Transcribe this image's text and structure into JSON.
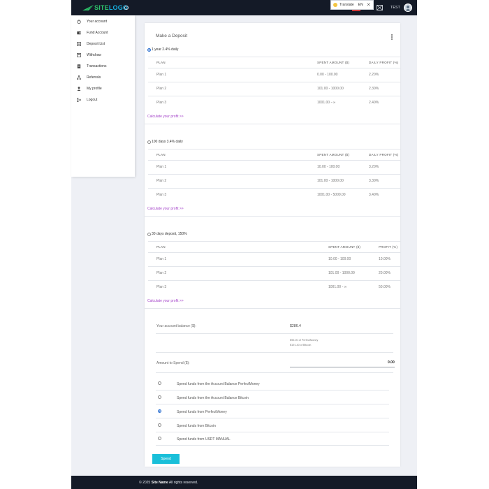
{
  "header": {
    "logo_part1": "SITE",
    "logo_part2": "LOGO",
    "translate_label": "Translate",
    "translate_lang": "EN",
    "translate_close": "✕",
    "user_name": "TEST"
  },
  "sidebar": {
    "items": [
      {
        "label": "Your account",
        "icon": "power-icon"
      },
      {
        "label": "Fund Account",
        "icon": "wallet-icon"
      },
      {
        "label": "Deposit List",
        "icon": "list-icon"
      },
      {
        "label": "Withdraw",
        "icon": "withdraw-icon"
      },
      {
        "label": "Transactions",
        "icon": "document-icon"
      },
      {
        "label": "Referrals",
        "icon": "network-icon"
      },
      {
        "label": "My profile",
        "icon": "user-icon"
      },
      {
        "label": "Logout",
        "icon": "logout-icon"
      }
    ]
  },
  "card": {
    "title": "Make a Deposit",
    "plans": [
      {
        "name": "1 year 2.4% daily",
        "selected": true,
        "columns": [
          "PLAN",
          "SPENT AMOUNT ($)",
          "DAILY PROFIT (%)"
        ],
        "rows": [
          [
            "Plan 1",
            "0.00 - 100.00",
            "2.20%"
          ],
          [
            "Plan 2",
            "101.00 - 1000.00",
            "2.30%"
          ],
          [
            "Plan 3",
            "1001.00 - ∞",
            "2.40%"
          ]
        ],
        "calc_link": "Calculate your profit >>"
      },
      {
        "name": "100 days 3.4% daily",
        "selected": false,
        "columns": [
          "PLAN",
          "SPENT AMOUNT ($)",
          "DAILY PROFIT (%)"
        ],
        "rows": [
          [
            "Plan 1",
            "10.00 - 100.00",
            "3.20%"
          ],
          [
            "Plan 2",
            "101.00 - 1000.00",
            "3.30%"
          ],
          [
            "Plan 3",
            "1001.00 - 5000.00",
            "3.40%"
          ]
        ],
        "calc_link": "Calculate your profit >>"
      },
      {
        "name": "30 days deposit, 150%",
        "selected": false,
        "columns": [
          "PLAN",
          "SPENT AMOUNT ($)",
          "PROFIT (%)"
        ],
        "rows": [
          [
            "Plan 1",
            "10.00 - 100.00",
            "10.00%"
          ],
          [
            "Plan 2",
            "101.00 - 1000.00",
            "20.00%"
          ],
          [
            "Plan 3",
            "1001.00 - ∞",
            "50.00%"
          ]
        ],
        "calc_link": "Calculate your profit >>"
      }
    ],
    "balance_label": "Your account balance ($):",
    "balance_value": "$286.4",
    "balance_pm": "$95.00 of PerfectMoney",
    "balance_btc": "$191.40 of Bitcoin",
    "amount_label": "Amount to Spend ($):",
    "amount_value": "0.00",
    "spend_options": [
      {
        "label": "Spend funds from the Account Balance PerfectMoney",
        "selected": false
      },
      {
        "label": "Spend funds from the Account Balance Bitcoin",
        "selected": false
      },
      {
        "label": "Spend funds from PerfectMoney",
        "selected": true
      },
      {
        "label": "Spend funds from Bitcoin",
        "selected": false
      },
      {
        "label": "Spend funds from USDT MANUAL",
        "selected": false
      }
    ],
    "spend_button": "Spend"
  },
  "footer": {
    "prefix": "© 2025",
    "site_name": "Site Name",
    "suffix": "All rights reserved."
  },
  "colors": {
    "header_bg": "#141a27",
    "accent_link": "#a23fc8",
    "button": "#19bfd9",
    "radio_selected": "#2b6fd0"
  }
}
